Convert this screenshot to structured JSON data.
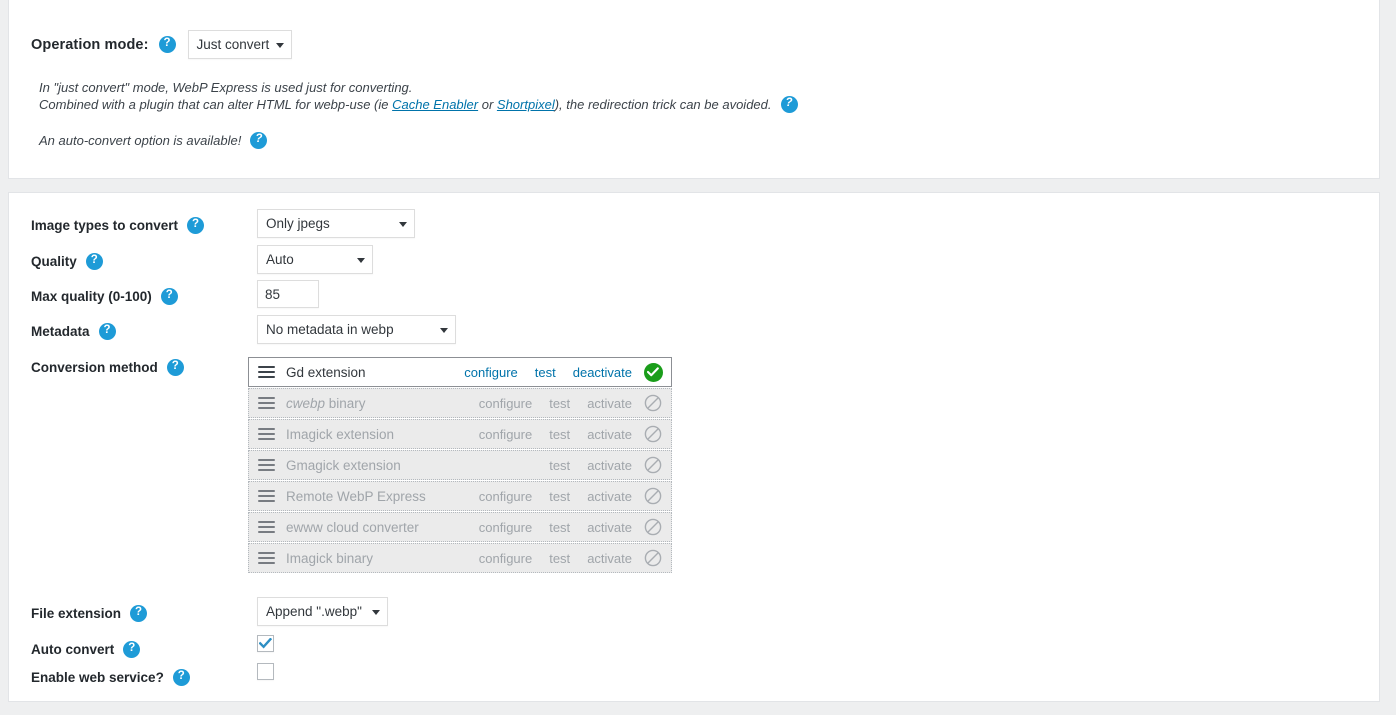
{
  "operation_mode": {
    "label": "Operation mode:",
    "value": "Just convert",
    "help_icon": "question-mark-icon",
    "description_line1": "In \"just convert\" mode, WebP Express is used just for converting.",
    "description_line2_pre": "Combined with a plugin that can alter HTML for webp-use (ie ",
    "link1": "Cache Enabler",
    "description_line2_mid": " or ",
    "link2": "Shortpixel",
    "description_line2_post": "), the redirection trick can be avoided.",
    "description_line3": "An auto-convert option is available!"
  },
  "settings": {
    "image_types": {
      "label": "Image types to convert",
      "value": "Only jpegs"
    },
    "quality": {
      "label": "Quality",
      "value": "Auto"
    },
    "max_quality": {
      "label": "Max quality (0-100)",
      "value": "85"
    },
    "metadata": {
      "label": "Metadata",
      "value": "No metadata in webp"
    },
    "conversion_method": {
      "label": "Conversion method"
    },
    "file_extension": {
      "label": "File extension",
      "value": "Append \".webp\""
    },
    "auto_convert": {
      "label": "Auto convert",
      "checked": true
    },
    "enable_web_service": {
      "label": "Enable web service?",
      "checked": false
    }
  },
  "conversion_methods": {
    "action_labels": {
      "configure": "configure",
      "test": "test",
      "activate": "activate",
      "deactivate": "deactivate"
    },
    "rows": [
      {
        "name": "Gd extension",
        "name_italic": "",
        "name_rest": "Gd extension",
        "state": "active",
        "has_configure": true,
        "toggle": "deactivate",
        "status_icon": "check-circle-icon"
      },
      {
        "name": "cwebp binary",
        "name_italic": "cwebp",
        "name_rest": " binary",
        "state": "inactive",
        "has_configure": true,
        "toggle": "activate",
        "status_icon": "no-entry-icon"
      },
      {
        "name": "Imagick extension",
        "name_italic": "",
        "name_rest": "Imagick extension",
        "state": "inactive",
        "has_configure": true,
        "toggle": "activate",
        "status_icon": "no-entry-icon"
      },
      {
        "name": "Gmagick extension",
        "name_italic": "",
        "name_rest": "Gmagick extension",
        "state": "inactive",
        "has_configure": false,
        "toggle": "activate",
        "status_icon": "no-entry-icon"
      },
      {
        "name": "Remote WebP Express",
        "name_italic": "",
        "name_rest": "Remote WebP Express",
        "state": "inactive",
        "has_configure": true,
        "toggle": "activate",
        "status_icon": "no-entry-icon"
      },
      {
        "name": "ewww cloud converter",
        "name_italic": "",
        "name_rest": "ewww cloud converter",
        "state": "inactive",
        "has_configure": true,
        "toggle": "activate",
        "status_icon": "no-entry-icon"
      },
      {
        "name": "Imagick binary",
        "name_italic": "",
        "name_rest": "Imagick binary",
        "state": "inactive",
        "has_configure": true,
        "toggle": "activate",
        "status_icon": "no-entry-icon"
      }
    ]
  },
  "colors": {
    "help_blue": "#1e9bd7",
    "link_blue": "#0073aa",
    "status_green": "#1a9d1a",
    "disabled_gray": "#a0a5aa",
    "panel_bg": "#ffffff",
    "page_bg": "#eeeff0",
    "inactive_row_bg": "#ebebeb"
  }
}
